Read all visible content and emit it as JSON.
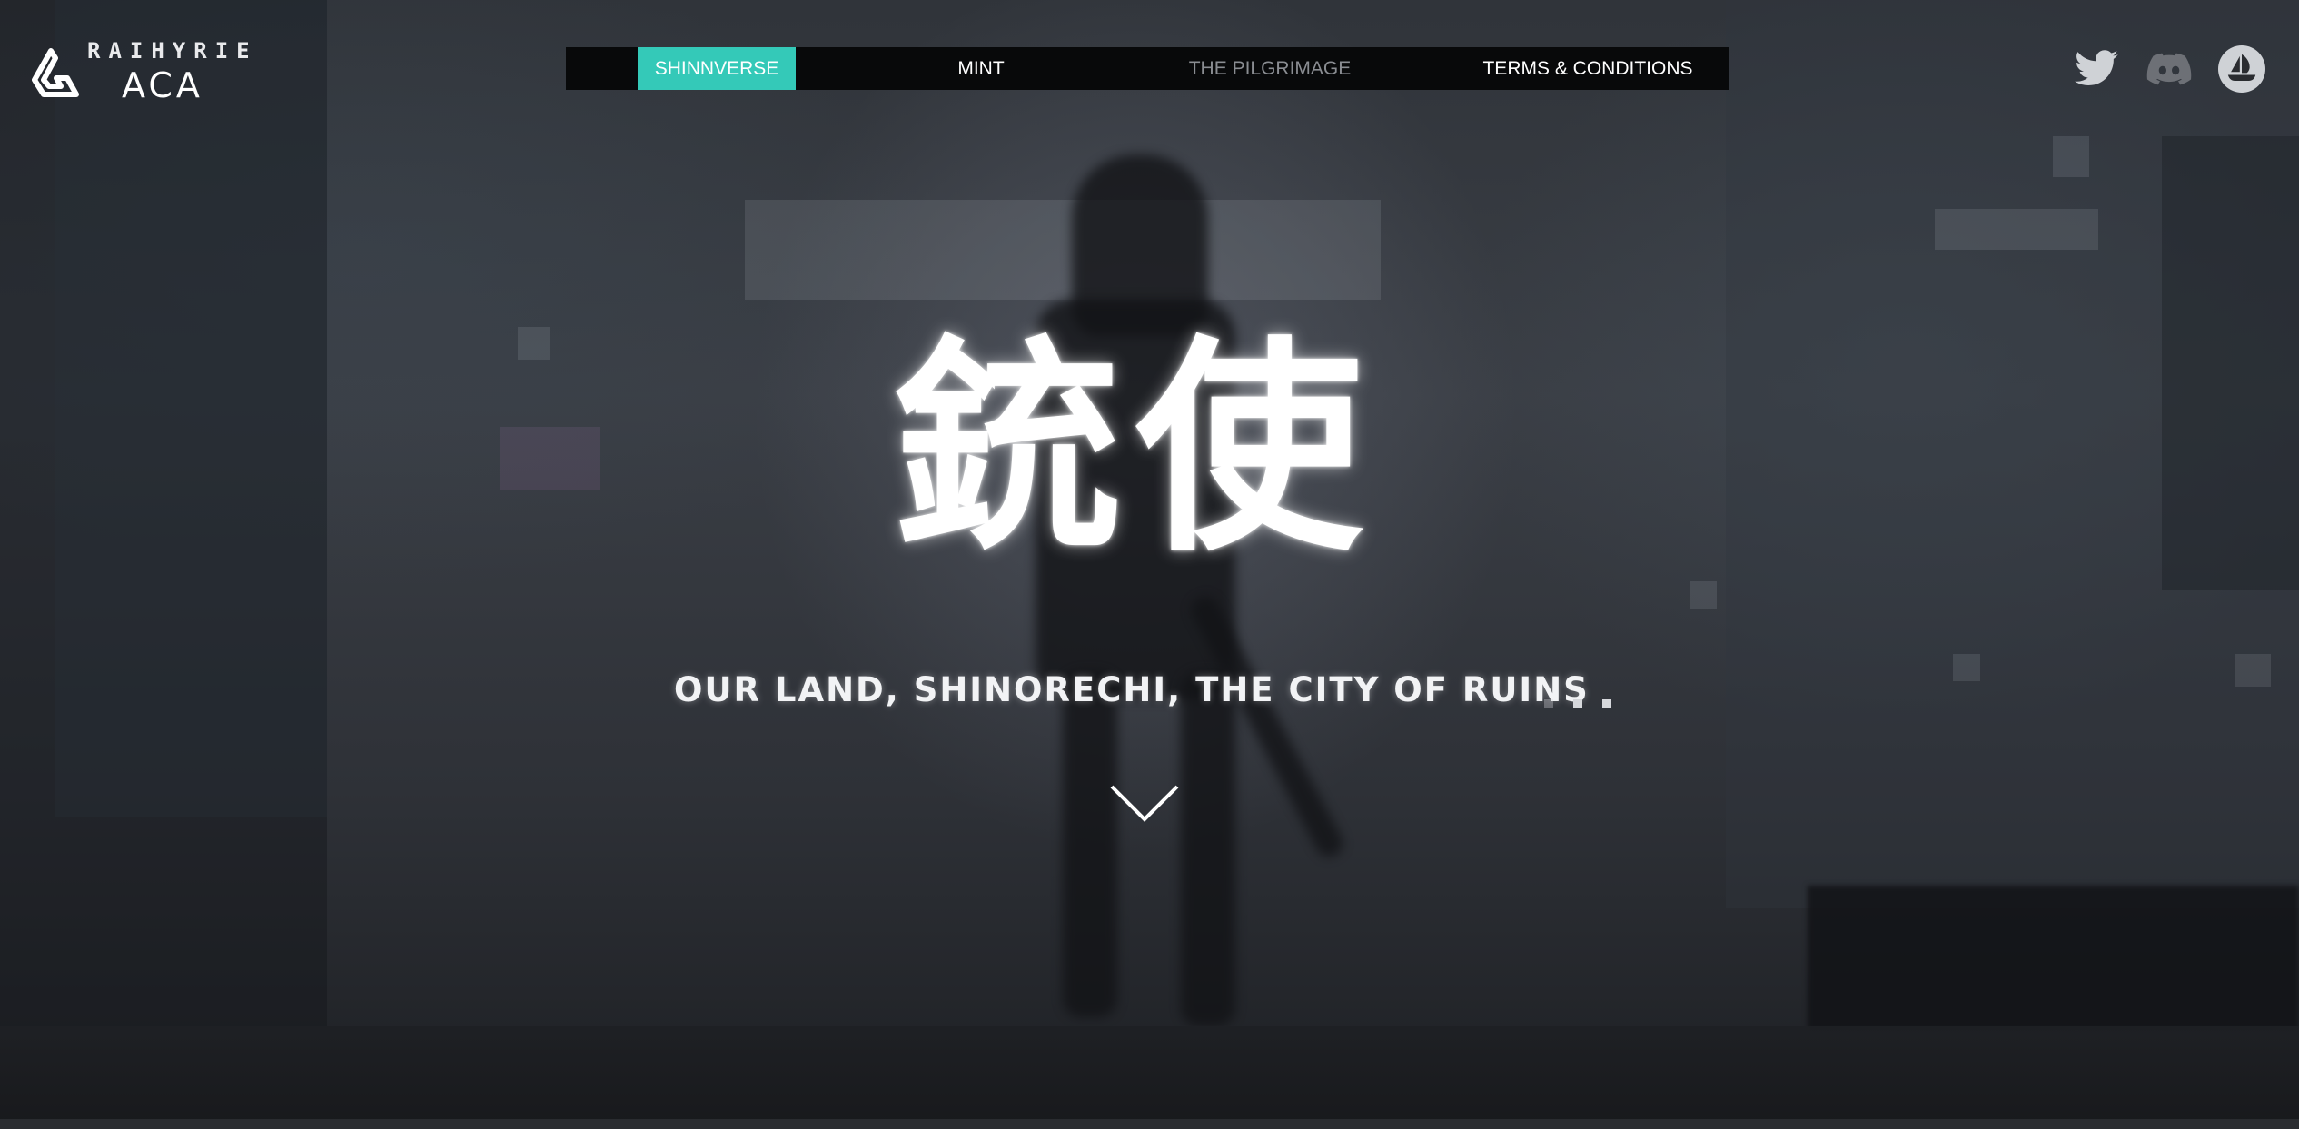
{
  "brand": {
    "top_text": "RAIHYRIE",
    "bottom_text": "ACA",
    "mark_icon": "triangle-loop-logo-icon"
  },
  "nav": {
    "items": [
      {
        "label": "SHINNVERSE",
        "state": "active"
      },
      {
        "label": "MINT",
        "state": "normal"
      },
      {
        "label": "THE PILGRIMAGE",
        "state": "dimmed"
      },
      {
        "label": "TERMS & CONDITIONS",
        "state": "normal"
      }
    ],
    "accent_color": "#34c9b8",
    "bar_color": "#08090a"
  },
  "social": {
    "twitter": {
      "icon": "twitter-icon"
    },
    "discord": {
      "icon": "discord-icon"
    },
    "opensea": {
      "icon": "opensea-icon"
    }
  },
  "hero": {
    "kanji": "銃使",
    "tagline": "OUR LAND, SHINORECHI, THE CITY OF RUINS",
    "scroll_icon": "chevron-down-icon"
  }
}
